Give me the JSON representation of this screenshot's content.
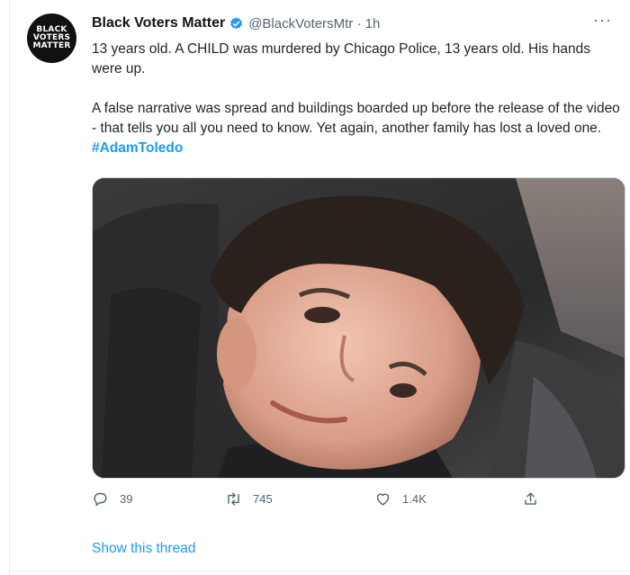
{
  "tweet": {
    "avatar_lines": [
      "BLACK",
      "VOTERS",
      "MATTER"
    ],
    "display_name": "Black Voters Matter",
    "handle_time": "@BlackVotersMtr · 1h",
    "more": "···",
    "paragraph1": "13 years old. A CHILD was murdered by Chicago Police, 13 years old. His hands were up.",
    "paragraph2_text": "A false narrative was spread and buildings boarded up before the release of the video - that tells you all you need to know. Yet again, another family has lost a loved one. ",
    "hashtag": "#AdamToledo",
    "verified_color": "#1d9bf0",
    "link_color": "#1d9bf0"
  },
  "actions": {
    "reply_count": "39",
    "retweet_count": "745",
    "like_count": "1.4K",
    "icons": [
      "reply-icon",
      "retweet-icon",
      "like-icon",
      "share-icon"
    ]
  },
  "thread": {
    "show_thread_label": "Show this thread"
  }
}
